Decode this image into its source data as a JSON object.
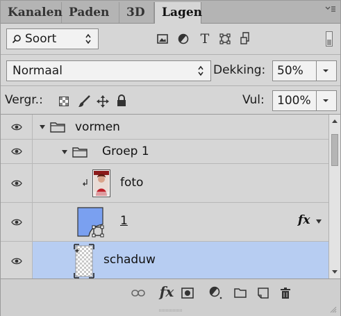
{
  "tabs": [
    {
      "label": "Kanalen"
    },
    {
      "label": "Paden"
    },
    {
      "label": "3D"
    },
    {
      "label": "Lagen"
    }
  ],
  "filter": {
    "kind_label": "Soort",
    "icons": [
      "image-filter-icon",
      "adjustment-filter-icon",
      "type-filter-icon",
      "shape-filter-icon",
      "smart-object-filter-icon"
    ]
  },
  "blend": {
    "mode": "Normaal",
    "opacity_label": "Dekking:",
    "opacity_value": "50%"
  },
  "lock": {
    "label": "Vergr.:",
    "fill_label": "Vul:",
    "fill_value": "100%"
  },
  "layers": [
    {
      "name": "vormen",
      "type": "group",
      "expanded": true
    },
    {
      "name": "Groep 1",
      "type": "group",
      "expanded": true
    },
    {
      "name": "foto",
      "type": "clipped-image"
    },
    {
      "name": "1",
      "type": "shape",
      "has_fx": true,
      "fx_label": "fx"
    },
    {
      "name": "schaduw",
      "type": "shape",
      "selected": true
    }
  ],
  "footer": {
    "fx_label": "fx"
  },
  "colors": {
    "panel_bg": "#d6d6d6",
    "selected_row": "#b7cdf2",
    "shape_fill": "#7aa0f0"
  }
}
